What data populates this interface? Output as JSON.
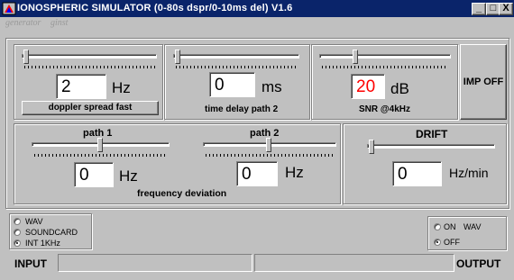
{
  "window": {
    "title": "IONOSPHERIC SIMULATOR (0-80s dspr/0-10ms del)   V1.6",
    "minimize_glyph": "_",
    "maximize_glyph": "□",
    "close_glyph": "X"
  },
  "menu": [
    "generator",
    "ginst"
  ],
  "doppler": {
    "value": "2",
    "unit": "Hz",
    "button_label": "doppler spread fast",
    "slider_fraction": 0.0
  },
  "delay": {
    "value": "0",
    "unit": "ms",
    "caption": "time delay path 2",
    "slider_fraction": 0.0
  },
  "snr": {
    "value": "20",
    "unit": "dB",
    "caption": "SNR @4kHz",
    "slider_fraction": 0.26,
    "value_color": "#ff0000"
  },
  "imp_button": "IMP OFF",
  "path1": {
    "label": "path 1",
    "value": "0",
    "unit": "Hz",
    "slider_fraction": 0.5
  },
  "path2": {
    "label": "path 2",
    "value": "0",
    "unit": "Hz",
    "slider_fraction": 0.5
  },
  "freq_caption": "frequency deviation",
  "drift": {
    "label": "DRIFT",
    "value": "0",
    "unit": "Hz/min",
    "slider_fraction": 0.0
  },
  "source_options": [
    {
      "label": "WAV",
      "selected": false
    },
    {
      "label": "SOUNDCARD",
      "selected": false
    },
    {
      "label": "INT 1KHz",
      "selected": true
    }
  ],
  "wav_output": {
    "label": "WAV",
    "on_label": "ON",
    "off_label": "OFF",
    "selected": "OFF"
  },
  "io": {
    "input_label": "INPUT",
    "output_label": "OUTPUT"
  }
}
